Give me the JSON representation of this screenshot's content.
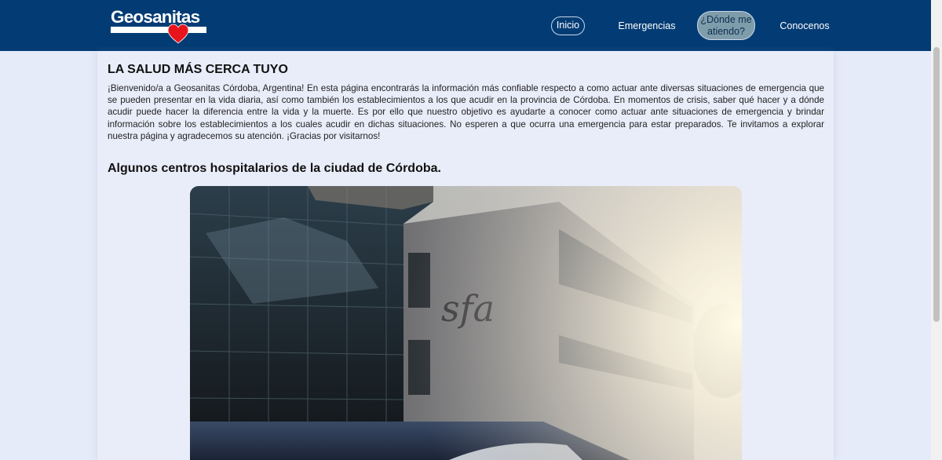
{
  "header": {
    "logo_text": "Geosanitas",
    "nav": {
      "inicio": "Inicio",
      "emergencias": "Emergencias",
      "donde_line1": "¿Dónde me",
      "donde_line2": "atiendo?",
      "conocenos": "Conocenos"
    }
  },
  "main": {
    "heading": "LA SALUD MÁS CERCA TUYO",
    "intro": "¡Bienvenido/a a Geosanitas Córdoba, Argentina! En esta página encontrarás la información más confiable respecto a como actuar ante diversas situaciones de emergencia que se pueden presentar en la vida diaria, así como también los establecimientos a los que acudir en la provincia de Córdoba. En momentos de crisis, saber qué hacer y a dónde acudir puede hacer la diferencia entre la vida y la muerte. Es por ello que nuestro objetivo es ayudarte a conocer como actuar ante situaciones de emergencia y brindar información sobre los establecimientos a los cuales acudir en dichas situaciones. No esperen a que ocurra una emergencia para estar preparados. Te invitamos a explorar nuestra página y agradecemos su atención. ¡Gracias por visitarnos!",
    "subheading": "Algunos centros hospitalarios de la ciudad de Córdoba."
  },
  "colors": {
    "nav_background": "#033c74",
    "page_background": "#e6ebf9",
    "active_pill": "#7f9cab",
    "heart": "#e8141c"
  },
  "icons": {
    "logo_heart": "heart-icon"
  }
}
